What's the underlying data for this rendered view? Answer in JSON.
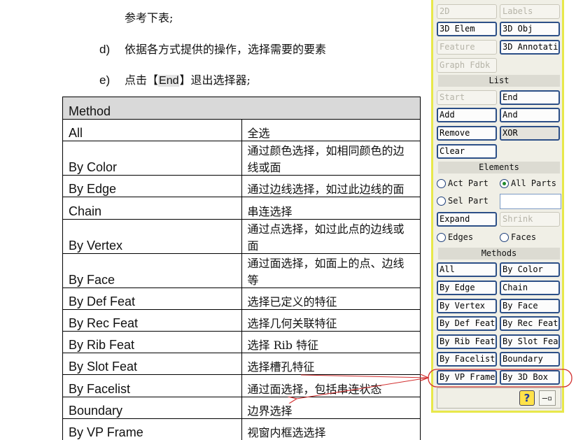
{
  "document": {
    "line_ref": "参考下表;",
    "step_d": {
      "letter": "d)",
      "text": "依据各方式提供的操作，选择需要的要素"
    },
    "step_e": {
      "letter": "e)",
      "before": "点击【",
      "key": "End",
      "after": "】退出选择器;"
    }
  },
  "table": {
    "header": "Method",
    "rows": [
      {
        "method": "All",
        "desc": "全选"
      },
      {
        "method": "By Color",
        "desc": "通过颜色选择，如相同颜色的边线或面"
      },
      {
        "method": "By Edge",
        "desc": "通过边线选择，如过此边线的面"
      },
      {
        "method": "Chain",
        "desc": "串连选择"
      },
      {
        "method": "By Vertex",
        "desc": "通过点选择，如过此点的边线或面"
      },
      {
        "method": "By Face",
        "desc": "通过面选择，如面上的点、边线等"
      },
      {
        "method": "By Def Feat",
        "desc": "选择已定义的特征"
      },
      {
        "method": "By Rec Feat",
        "desc": "选择几何关联特征"
      },
      {
        "method": "By Rib Feat",
        "desc": "选择 Rib 特征"
      },
      {
        "method": "By Slot Feat",
        "desc": "选择槽孔特征"
      },
      {
        "method": "By Facelist",
        "desc": "通过面选择，包括串连状态"
      },
      {
        "method": "Boundary",
        "desc": "边界选择"
      },
      {
        "method": "By VP Frame",
        "desc": "视窗内框选选择"
      }
    ]
  },
  "panel": {
    "top_buttons": [
      {
        "label": "2D",
        "enabled": false
      },
      {
        "label": "Labels",
        "enabled": false
      },
      {
        "label": "3D Elem",
        "enabled": true
      },
      {
        "label": "3D Obj",
        "enabled": true
      },
      {
        "label": "Feature",
        "enabled": false
      },
      {
        "label": "3D Annotati",
        "enabled": true
      },
      {
        "label": "Graph Fdbk",
        "enabled": false
      }
    ],
    "list_title": "List",
    "list_buttons": [
      {
        "label": "Start",
        "enabled": false
      },
      {
        "label": "End",
        "enabled": true
      },
      {
        "label": "Add",
        "enabled": true
      },
      {
        "label": "And",
        "enabled": true
      },
      {
        "label": "Remove",
        "enabled": true
      },
      {
        "label": "XOR",
        "enabled": true
      },
      {
        "label": "Clear",
        "enabled": true
      }
    ],
    "elements_title": "Elements",
    "act_part": "Act Part",
    "all_parts": "All Parts",
    "sel_part": "Sel Part",
    "expand": "Expand",
    "shrink": "Shrink",
    "edges": "Edges",
    "faces": "Faces",
    "selected_radio": "All Parts",
    "methods_title": "Methods",
    "method_buttons": [
      "All",
      "By Color",
      "By Edge",
      "Chain",
      "By Vertex",
      "By Face",
      "By Def Feat",
      "By Rec Feat",
      "By Rib Feat",
      "By Slot Fea",
      "By Facelist",
      "Boundary",
      "By VP Frame",
      "By 3D Box"
    ],
    "help_glyph": "?",
    "pin_glyph": "—▫",
    "icons": [
      "help-icon",
      "pin-icon"
    ],
    "colors": {
      "panel_border": "#e8e84a",
      "button_border": "#2c4f87",
      "annotation": "#d23030"
    }
  }
}
